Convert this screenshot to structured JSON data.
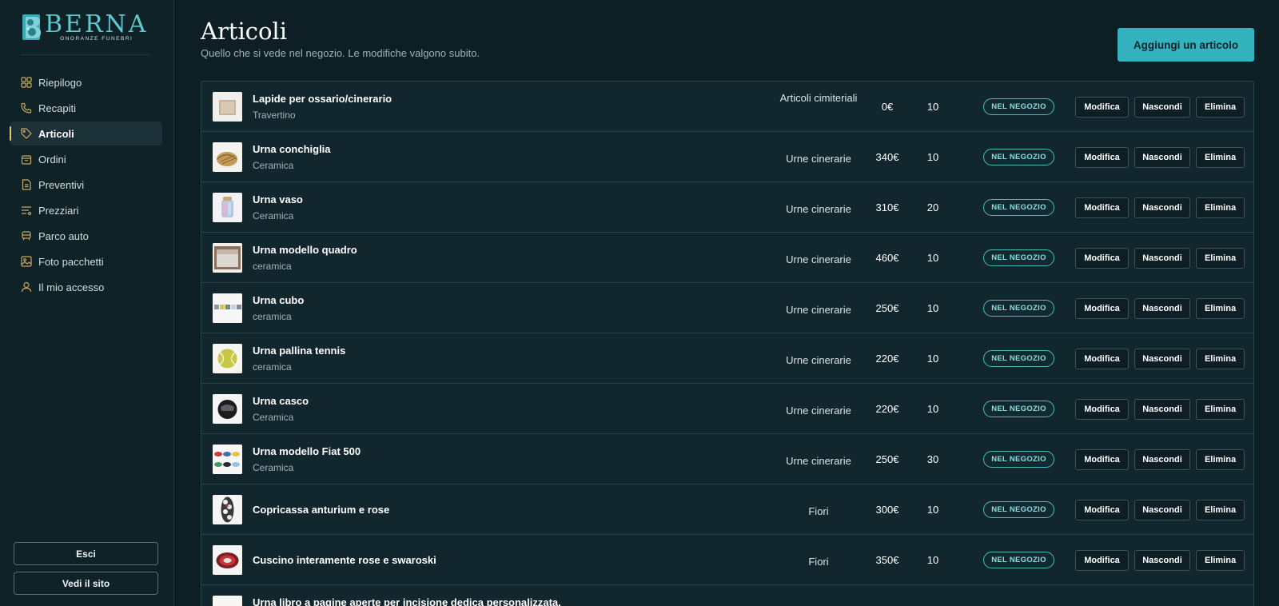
{
  "brand": {
    "name": "BERNA",
    "tagline": "ONORANZE FUNEBRI"
  },
  "sidebar": {
    "items": [
      {
        "label": "Riepilogo",
        "icon": "grid-icon",
        "active": false
      },
      {
        "label": "Recapiti",
        "icon": "phone-icon",
        "active": false
      },
      {
        "label": "Articoli",
        "icon": "tag-icon",
        "active": true
      },
      {
        "label": "Ordini",
        "icon": "shopping-bag-icon",
        "active": false
      },
      {
        "label": "Preventivi",
        "icon": "document-icon",
        "active": false
      },
      {
        "label": "Prezziari",
        "icon": "list-filter-icon",
        "active": false
      },
      {
        "label": "Parco auto",
        "icon": "car-icon",
        "active": false
      },
      {
        "label": "Foto pacchetti",
        "icon": "image-icon",
        "active": false
      },
      {
        "label": "Il mio accesso",
        "icon": "user-icon",
        "active": false
      }
    ],
    "logout_label": "Esci",
    "site_label": "Vedi il sito"
  },
  "header": {
    "title": "Articoli",
    "subtitle": "Quello che si vede nel negozio. Le modifiche valgono subito.",
    "add_label": "Aggiungi un articolo"
  },
  "actions": {
    "edit": "Modifica",
    "hide": "Nascondi",
    "delete": "Elimina"
  },
  "articles": [
    {
      "name": "Lapide per ossario/cinerario",
      "material": "Travertino",
      "category": "Articoli cimiteriali",
      "price": "0€",
      "qty": "10",
      "status": "NEL NEGOZIO"
    },
    {
      "name": "Urna conchiglia",
      "material": "Ceramica",
      "category": "Urne cinerarie",
      "price": "340€",
      "qty": "10",
      "status": "NEL NEGOZIO"
    },
    {
      "name": "Urna vaso",
      "material": "Ceramica",
      "category": "Urne cinerarie",
      "price": "310€",
      "qty": "20",
      "status": "NEL NEGOZIO"
    },
    {
      "name": "Urna modello quadro",
      "material": "ceramica",
      "category": "Urne cinerarie",
      "price": "460€",
      "qty": "10",
      "status": "NEL NEGOZIO"
    },
    {
      "name": "Urna cubo",
      "material": "ceramica",
      "category": "Urne cinerarie",
      "price": "250€",
      "qty": "10",
      "status": "NEL NEGOZIO"
    },
    {
      "name": "Urna pallina tennis",
      "material": "ceramica",
      "category": "Urne cinerarie",
      "price": "220€",
      "qty": "10",
      "status": "NEL NEGOZIO"
    },
    {
      "name": "Urna casco",
      "material": "Ceramica",
      "category": "Urne cinerarie",
      "price": "220€",
      "qty": "10",
      "status": "NEL NEGOZIO"
    },
    {
      "name": "Urna modello Fiat 500",
      "material": "Ceramica",
      "category": "Urne cinerarie",
      "price": "250€",
      "qty": "30",
      "status": "NEL NEGOZIO"
    },
    {
      "name": "Copricassa anturium e rose",
      "material": "",
      "category": "Fiori",
      "price": "300€",
      "qty": "10",
      "status": "NEL NEGOZIO"
    },
    {
      "name": "Cuscino interamente rose e swaroski",
      "material": "",
      "category": "Fiori",
      "price": "350€",
      "qty": "10",
      "status": "NEL NEGOZIO"
    },
    {
      "name": "Urna libro a pagine aperte per incisione dedica personalizzata.",
      "material": "",
      "category": "",
      "price": "",
      "qty": "",
      "status": ""
    }
  ],
  "colors": {
    "accent": "#33b3bd",
    "active_marker": "#e6c774",
    "background": "#0d1f25"
  }
}
